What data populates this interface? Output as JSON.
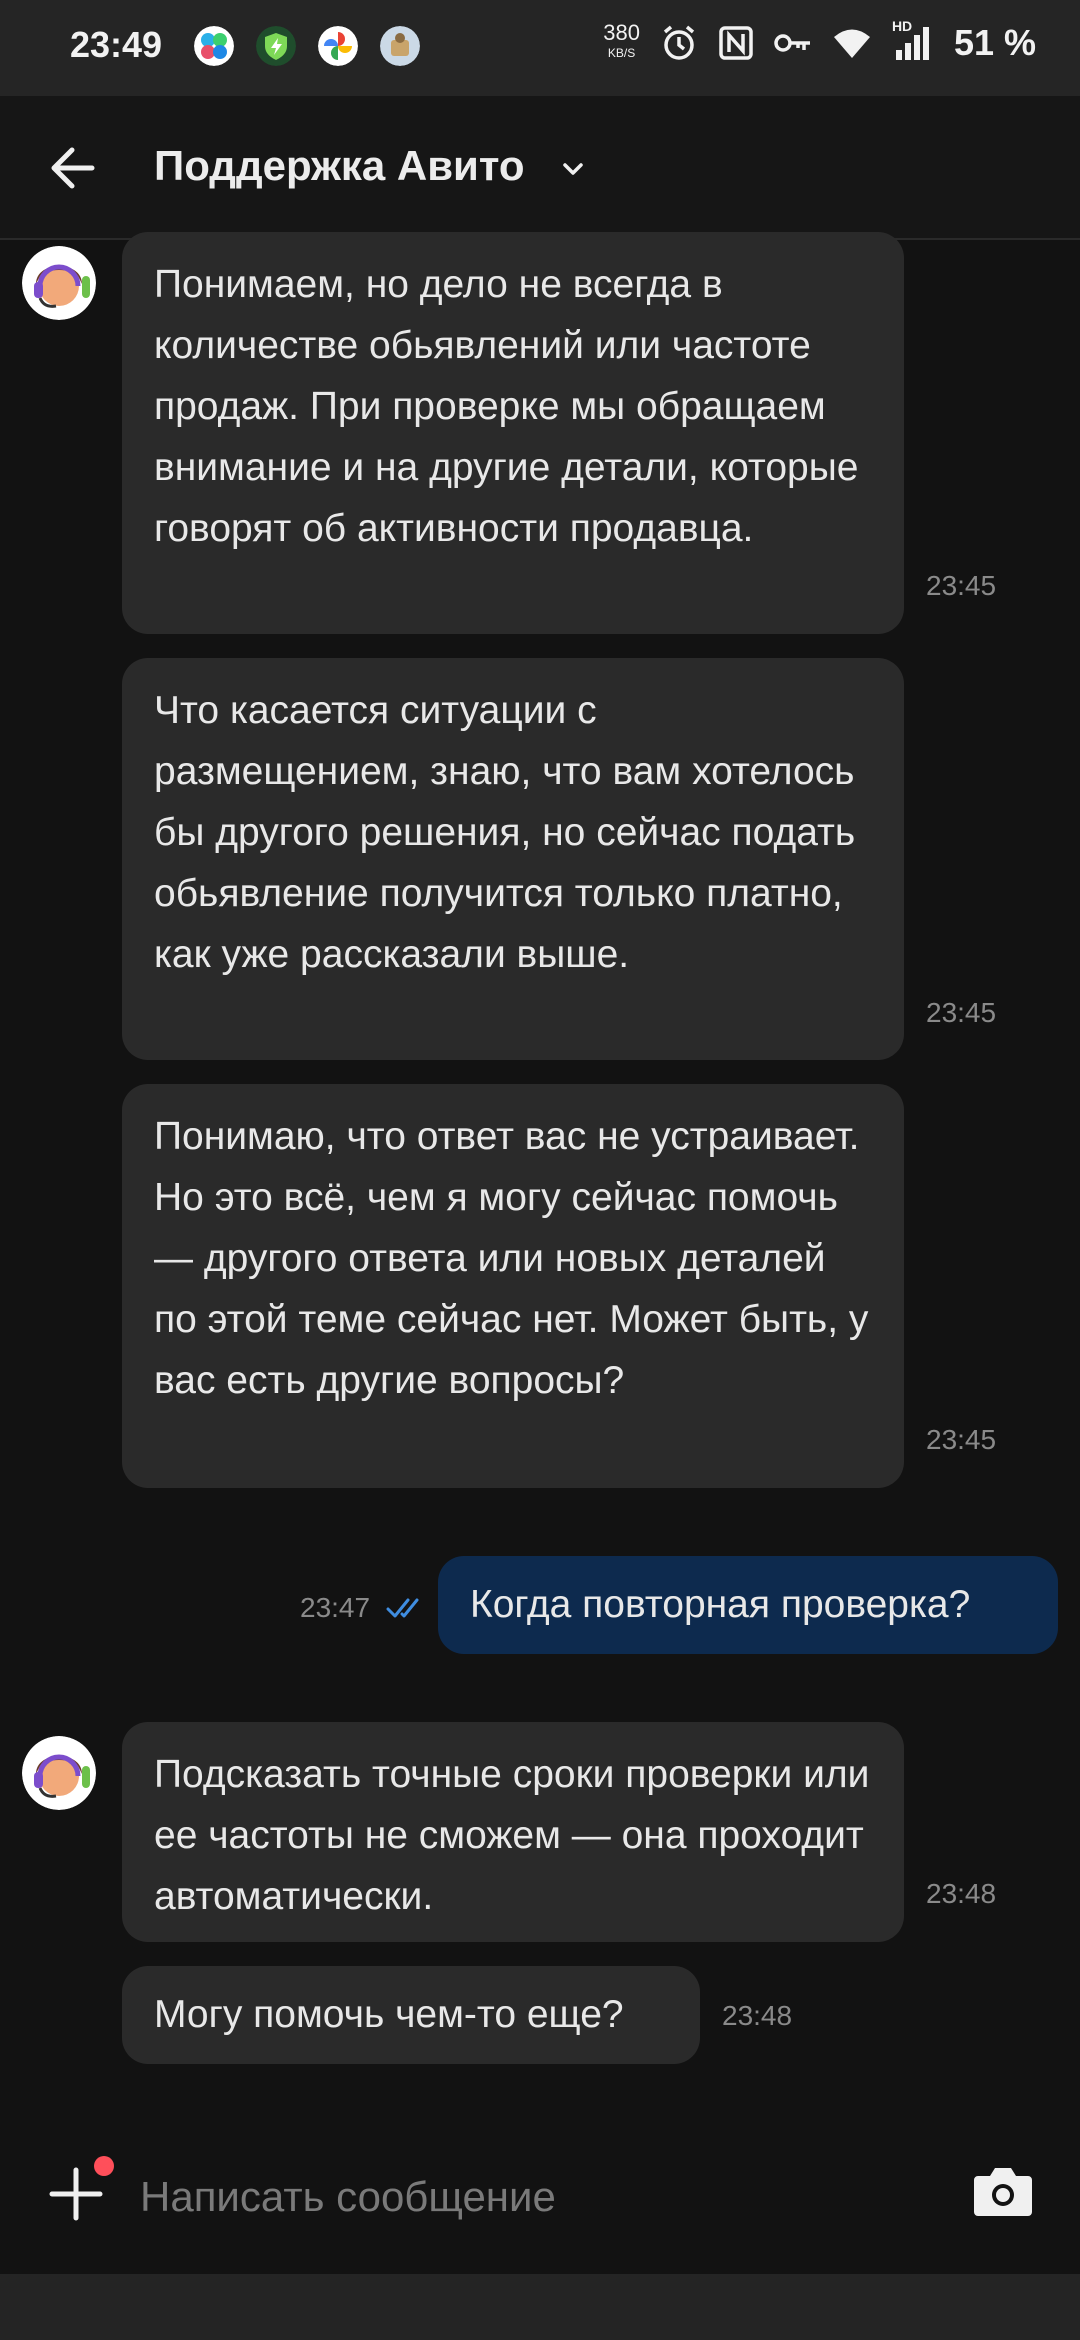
{
  "status_bar": {
    "time": "23:49",
    "net_speed": "380",
    "net_unit": "KB/S",
    "network_label": "HD",
    "battery": "51 %",
    "icons": [
      "gallery-icon",
      "vpn-icon",
      "pinwheel-icon",
      "app-icon",
      "alarm-icon",
      "nfc-icon",
      "key-icon",
      "wifi-icon",
      "signal-icon"
    ]
  },
  "header": {
    "title": "Поддержка Авито"
  },
  "messages": [
    {
      "text": "Понимаем, но дело не всегда в количестве обьявлений или частоте продаж. При проверке мы обращаем внимание и на другие детали, которые говорят об активности продавца.",
      "time": "23:45"
    },
    {
      "text": "Что касается ситуации с размещением, знаю, что вам хотелось бы другого решения, но сейчас подать обьявление получится только платно, как уже рассказали выше.",
      "time": "23:45"
    },
    {
      "text": "Понимаю, что ответ вас не устраивает. Но это всё, чем я могу сейчас помочь — другого ответа или новых деталей по этой теме сейчас нет. Может быть, у вас есть другие вопросы?",
      "time": "23:45"
    },
    {
      "text": "Когда повторная проверка?",
      "time": "23:47"
    },
    {
      "text": "Подсказать точные сроки проверки или ее частоты не сможем — она проходит автоматически.",
      "time": "23:48"
    },
    {
      "text": "Могу помочь чем-то еще?",
      "time": "23:48"
    }
  ],
  "composer": {
    "placeholder": "Написать сообщение"
  },
  "colors": {
    "background": "#121212",
    "incoming_bubble": "#2a2a2a",
    "outgoing_bubble": "#0d2a4e",
    "read_check": "#3f8de0",
    "attach_badge": "#ff4f5a"
  }
}
